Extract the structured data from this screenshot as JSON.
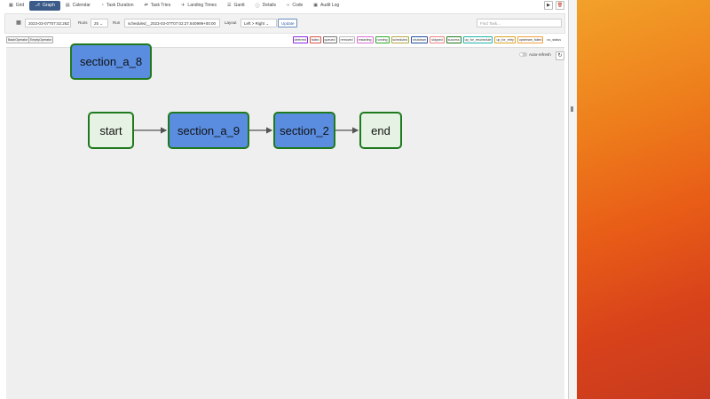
{
  "tabs": [
    {
      "label": "Grid",
      "icon": "grid-icon",
      "glyph": "▦",
      "active": false
    },
    {
      "label": "Graph",
      "icon": "graph-icon",
      "glyph": "⎇",
      "active": true
    },
    {
      "label": "Calendar",
      "icon": "calendar-icon",
      "glyph": "▤",
      "active": false
    },
    {
      "label": "Task Duration",
      "icon": "duration-icon",
      "glyph": "◔",
      "active": false
    },
    {
      "label": "Task Tries",
      "icon": "tries-icon",
      "glyph": "⇄",
      "active": false
    },
    {
      "label": "Landing Times",
      "icon": "landing-icon",
      "glyph": "✈",
      "active": false
    },
    {
      "label": "Gantt",
      "icon": "gantt-icon",
      "glyph": "☰",
      "active": false
    },
    {
      "label": "Details",
      "icon": "details-icon",
      "glyph": "ⓘ",
      "active": false
    },
    {
      "label": "Code",
      "icon": "code-icon",
      "glyph": "‹›",
      "active": false
    },
    {
      "label": "Audit Log",
      "icon": "audit-icon",
      "glyph": "▣",
      "active": false
    }
  ],
  "toolbar": {
    "date_value": "2023-03-07T07:02:26Z",
    "runs_label": "Runs",
    "runs_value": "25",
    "run_label": "Run",
    "run_value": "scheduled__2023-03-07T07:02:27.840999+00:00",
    "layout_label": "Layout",
    "layout_value": "Left > Right",
    "update_label": "Update",
    "find_placeholder": "Find Task..."
  },
  "operators": [
    "BashOperator",
    "EmptyOperator"
  ],
  "legend": [
    {
      "label": "deferred",
      "color": "#8a2be2"
    },
    {
      "label": "failed",
      "color": "#d9534f"
    },
    {
      "label": "queued",
      "color": "#777777"
    },
    {
      "label": "removed",
      "color": "#bbbbbb"
    },
    {
      "label": "restarting",
      "color": "#da70d6"
    },
    {
      "label": "running",
      "color": "#2eaa2e"
    },
    {
      "label": "scheduled",
      "color": "#b5a642"
    },
    {
      "label": "shutdown",
      "color": "#1f4fa0"
    },
    {
      "label": "skipped",
      "color": "#f08080"
    },
    {
      "label": "success",
      "color": "#1f7a1f"
    },
    {
      "label": "up_for_reschedule",
      "color": "#20b2aa"
    },
    {
      "label": "up_for_retry",
      "color": "#daa520"
    },
    {
      "label": "upstream_failed",
      "color": "#f0a040"
    },
    {
      "label": "no_status",
      "color": "#ffffff"
    }
  ],
  "graph": {
    "auto_refresh_label": "Auto-refresh",
    "nodes": {
      "section_a_8": "section_a_8",
      "start": "start",
      "section_a_9": "section_a_9",
      "section_2": "section_2",
      "end": "end"
    }
  },
  "colors": {
    "task_fill": "#5a8de0",
    "empty_fill": "#e6f2e3",
    "success_border": "#1f7a1f",
    "active_tab": "#3b5b88"
  }
}
